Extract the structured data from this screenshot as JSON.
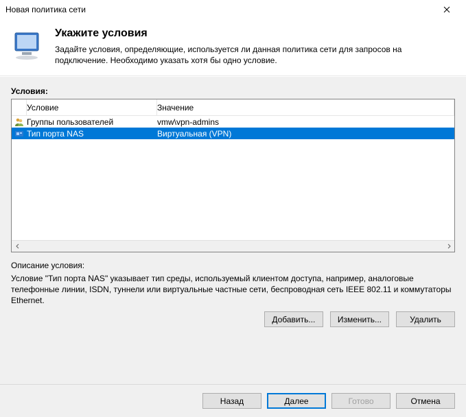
{
  "window": {
    "title": "Новая политика сети"
  },
  "header": {
    "title": "Укажите условия",
    "subtitle": "Задайте условия, определяющие, используется ли данная политика сети для запросов на подключение. Необходимо указать хотя бы одно условие."
  },
  "conditions": {
    "section_label": "Условия:",
    "columns": {
      "condition": "Условие",
      "value": "Значение"
    },
    "rows": [
      {
        "icon": "users-icon",
        "condition": "Группы пользователей",
        "value": "vmw\\vpn-admins",
        "selected": false
      },
      {
        "icon": "port-icon",
        "condition": "Тип порта NAS",
        "value": "Виртуальная (VPN)",
        "selected": true
      }
    ]
  },
  "description": {
    "label": "Описание условия:",
    "text": "Условие \"Тип порта NAS\" указывает тип среды, используемый клиентом доступа, например, аналоговые телефонные линии, ISDN, туннели или виртуальные частные сети, беспроводная сеть IEEE 802.11 и коммутаторы Ethernet."
  },
  "actions": {
    "add": "Добавить...",
    "edit": "Изменить...",
    "remove": "Удалить"
  },
  "wizard": {
    "back": "Назад",
    "next": "Далее",
    "finish": "Готово",
    "cancel": "Отмена"
  }
}
